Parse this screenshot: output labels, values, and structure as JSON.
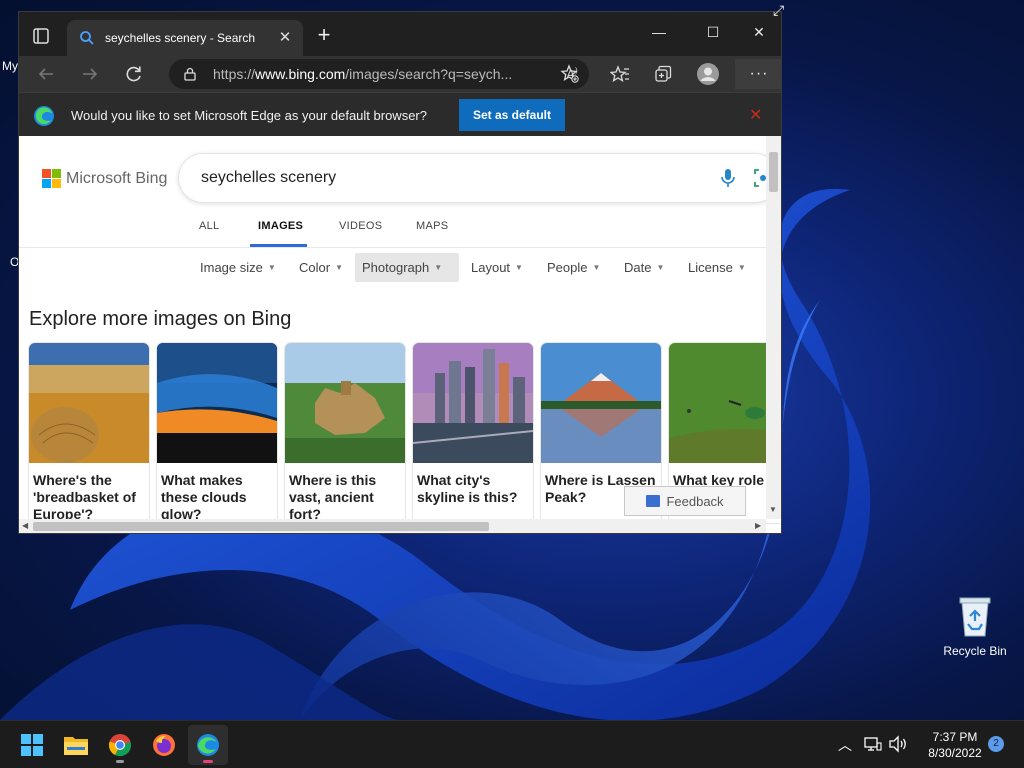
{
  "desktop": {
    "fragments": [
      "My",
      "O"
    ],
    "recycle_bin_label": "Recycle Bin"
  },
  "browser": {
    "tab_title": "seychelles scenery - Search",
    "address_prefix": "https://",
    "address_domain": "www.bing.com",
    "address_rest": "/images/search?q=seych...",
    "infobar_text": "Would you like to set Microsoft Edge as your default browser?",
    "set_default_label": "Set as default",
    "icons": [
      "tab-actions-icon",
      "back-icon",
      "forward-icon",
      "refresh-icon",
      "lock-icon",
      "read-aloud-icon",
      "add-favorite-icon",
      "favorites-icon",
      "collections-icon",
      "profile-icon",
      "more-icon"
    ]
  },
  "bing": {
    "logo_text": "Microsoft Bing",
    "query": "seychelles scenery",
    "nav": [
      "ALL",
      "IMAGES",
      "VIDEOS",
      "MAPS"
    ],
    "active_nav": "IMAGES",
    "filters": [
      "Image size",
      "Color",
      "Photograph",
      "Layout",
      "People",
      "Date",
      "License"
    ],
    "active_filter": "Photograph",
    "explore_title": "Explore more images on Bing",
    "cards": [
      {
        "caption": "Where's the 'breadbasket of Europe'?"
      },
      {
        "caption": "What makes these clouds glow?"
      },
      {
        "caption": "Where is this vast, ancient fort?"
      },
      {
        "caption": "What city's skyline is this?"
      },
      {
        "caption": "Where is Lassen Peak?"
      },
      {
        "caption": "What key role d... play?"
      }
    ],
    "feedback_label": "Feedback"
  },
  "taskbar": {
    "apps": [
      "start-icon",
      "file-explorer-icon",
      "chrome-icon",
      "firefox-icon",
      "edge-icon"
    ],
    "time": "7:37 PM",
    "date": "8/30/2022",
    "notification_count": "2"
  },
  "colors": {
    "edge_accent": "#0f6cbd",
    "bing_tab_underline": "#2e6bd6",
    "taskbar_bg": "#1c1c1c"
  }
}
